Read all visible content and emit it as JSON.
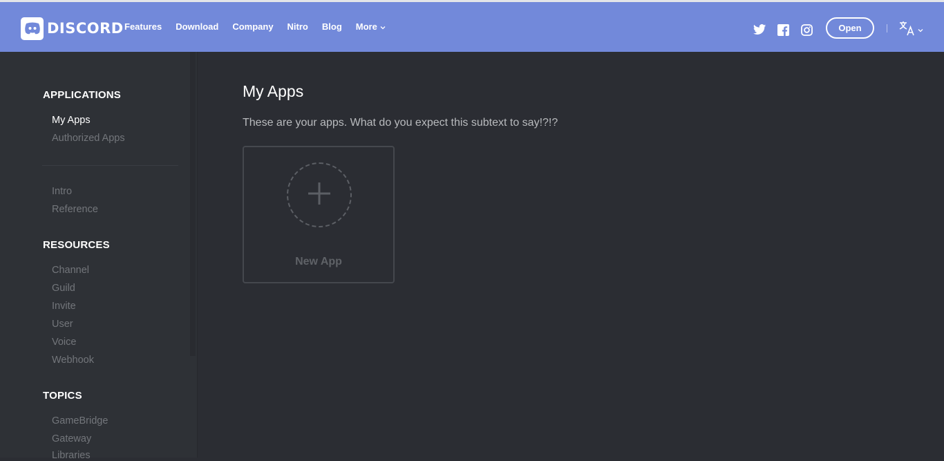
{
  "brand": {
    "name": "DISCORD"
  },
  "nav": {
    "items": [
      "Features",
      "Download",
      "Company",
      "Nitro",
      "Blog"
    ],
    "more_label": "More"
  },
  "header": {
    "open_label": "Open"
  },
  "social": [
    "twitter-icon",
    "facebook-icon",
    "instagram-icon"
  ],
  "sidebar": {
    "sections": [
      {
        "title": "APPLICATIONS",
        "items": [
          "My Apps",
          "Authorized Apps"
        ]
      },
      {
        "title": "",
        "items": [
          "Intro",
          "Reference"
        ]
      },
      {
        "title": "RESOURCES",
        "items": [
          "Channel",
          "Guild",
          "Invite",
          "User",
          "Voice",
          "Webhook"
        ]
      },
      {
        "title": "TOPICS",
        "items": [
          "GameBridge",
          "Gateway",
          "Libraries"
        ]
      }
    ],
    "active": "My Apps"
  },
  "main": {
    "title": "My Apps",
    "subtitle": "These are your apps. What do you expect this subtext to say!?!?",
    "new_app_label": "New App"
  },
  "colors": {
    "header": "#7289da",
    "background": "#2b2d33",
    "sidebar": "#2e3136"
  }
}
